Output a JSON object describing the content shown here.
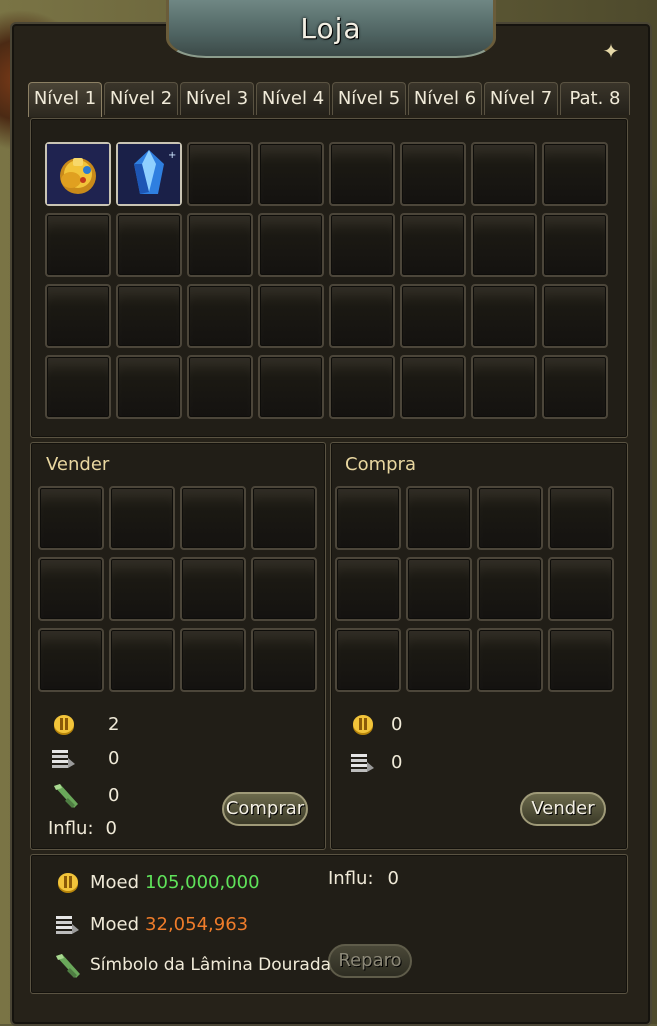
{
  "window": {
    "title": "Loja"
  },
  "tabs": [
    "Nível 1",
    "Nível 2",
    "Nível 3",
    "Nível 4",
    "Nível 5",
    "Nível 6",
    "Nível 7",
    "Pat. 8"
  ],
  "shop_items": [
    "golden-trumpet-item",
    "blue-crystal-item"
  ],
  "sell": {
    "label": "Vender",
    "coin_value": "2",
    "silver_value": "0",
    "blade_value": "0",
    "influ_label": "Influ:",
    "influ_value": "0",
    "button_label": "Comprar"
  },
  "buy": {
    "label": "Compra",
    "coin_value": "0",
    "silver_value": "0",
    "button_label": "Vender"
  },
  "footer": {
    "moed_label_1": "Moed",
    "moed_value_1": "105,000,000",
    "moed_label_2": "Moed",
    "moed_value_2": "32,054,963",
    "blade_label": "Símbolo da Lâmina Dourada",
    "influ_label": "Influ:",
    "influ_value": "0",
    "repair_label": "Reparo"
  },
  "colors": {
    "gold_green": "#5fe35a",
    "orange": "#ef7c2a",
    "label_gold": "#e9d7a0"
  }
}
